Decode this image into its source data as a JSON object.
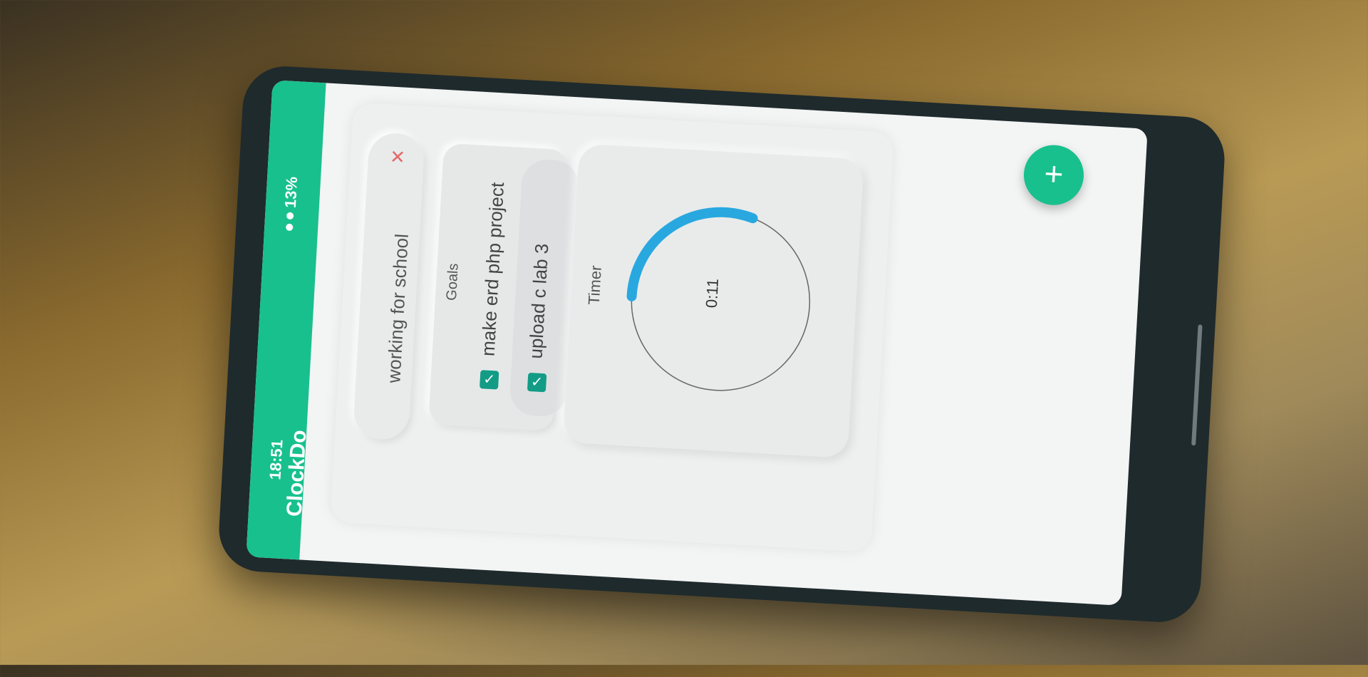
{
  "status_bar": {
    "time": "18:51",
    "battery": "13%"
  },
  "app": {
    "title": "ClockDo"
  },
  "task": {
    "name": "working for school",
    "close_icon": "close-icon"
  },
  "goals": {
    "title": "Goals",
    "items": [
      {
        "label": "make erd php project",
        "checked": true
      },
      {
        "label": "upload c lab 3",
        "checked": true
      }
    ]
  },
  "timer": {
    "title": "Timer",
    "value": "0:11",
    "progress_fraction": 0.3,
    "arc_color": "#29a8e0"
  },
  "fab": {
    "label": "+",
    "color": "#18c08d"
  },
  "colors": {
    "accent": "#18c08d",
    "checkbox": "#129c86",
    "close": "#e46a6a"
  }
}
